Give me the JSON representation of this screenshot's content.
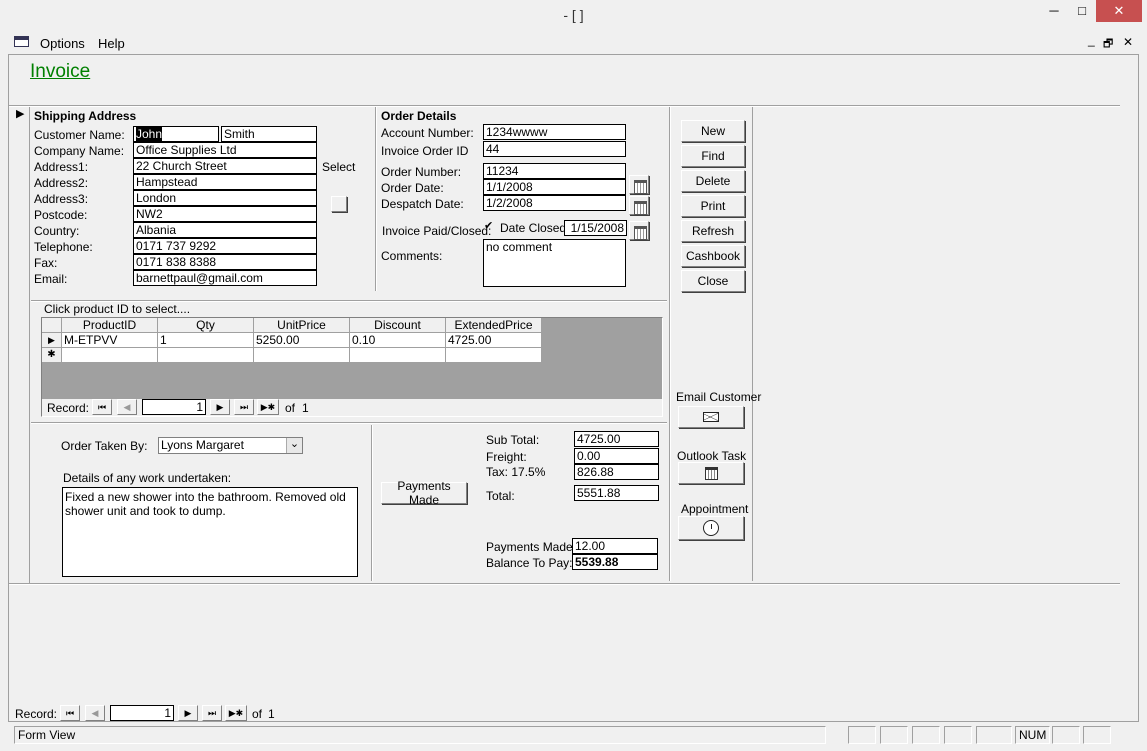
{
  "window": {
    "title": "- [ ]",
    "minimize": "─",
    "maximize": "□",
    "close": "✕"
  },
  "menu": {
    "options": "Options",
    "help": "Help",
    "mdi_min": "_",
    "mdi_restore": "🗗",
    "mdi_close": "✕"
  },
  "form": {
    "title": "Invoice"
  },
  "shipping": {
    "header": "Shipping Address",
    "select_label": "Select",
    "labels": {
      "customer_name": "Customer Name:",
      "company_name": "Company Name:",
      "address1": "Address1:",
      "address2": "Address2:",
      "address3": "Address3:",
      "postcode": "Postcode:",
      "country": "Country:",
      "telephone": "Telephone:",
      "fax": "Fax:",
      "email": "Email:"
    },
    "values": {
      "first_name": "John",
      "last_name": "Smith",
      "company_name": "Office Supplies Ltd",
      "address1": "22 Church Street",
      "address2": "Hampstead",
      "address3": "London",
      "postcode": "NW2",
      "country": "Albania",
      "telephone": "0171 737 9292",
      "fax": "0171 838 8388",
      "email": "barnettpaul@gmail.com"
    }
  },
  "order": {
    "header": "Order Details",
    "labels": {
      "account_number": "Account Number:",
      "invoice_order_id": "Invoice Order ID",
      "order_number": "Order Number:",
      "order_date": "Order Date:",
      "despatch_date": "Despatch Date:",
      "invoice_paid_closed": "Invoice Paid/Closed:",
      "date_closed": "Date Closed:",
      "comments": "Comments:"
    },
    "values": {
      "account_number": "1234wwww",
      "invoice_order_id": "44",
      "order_number": "11234",
      "order_date": "1/1/2008",
      "despatch_date": "1/2/2008",
      "date_closed": "1/15/2008",
      "comments": "no comment",
      "paid_checkmark": "✔"
    }
  },
  "actions": {
    "new": "New",
    "find": "Find",
    "delete": "Delete",
    "print": "Print",
    "refresh": "Refresh",
    "cashbook": "Cashbook",
    "close": "Close",
    "email_customer": "Email Customer",
    "outlook_task": "Outlook Task",
    "appointment": "Appointment"
  },
  "products": {
    "hint": "Click product ID to select....",
    "columns": [
      "ProductID",
      "Qty",
      "UnitPrice",
      "Discount",
      "ExtendedPrice"
    ],
    "rows": [
      [
        "M-ETPVV",
        "1",
        "5250.00",
        "0.10",
        "4725.00"
      ]
    ],
    "new_row_marker": "✱",
    "current_row_marker": "▶",
    "nav": {
      "label": "Record:",
      "current": "1",
      "of": "of",
      "total": "1"
    }
  },
  "work": {
    "order_taken_by_label": "Order Taken By:",
    "order_taken_by_value": "Lyons Margaret",
    "details_label": "Details of any work undertaken:",
    "details_value": "Fixed a new shower into the bathroom. Removed old shower unit and took to dump."
  },
  "totals": {
    "payments_made_button": "Payments Made",
    "labels": {
      "sub_total": "Sub Total:",
      "freight": "Freight:",
      "tax": "Tax: 17.5%",
      "total": "Total:",
      "payments_made": "Payments Made:",
      "balance": "Balance To Pay:"
    },
    "values": {
      "sub_total": "4725.00",
      "freight": "0.00",
      "tax": "826.88",
      "total": "5551.88",
      "payments_made": "12.00",
      "balance": "5539.88"
    }
  },
  "record_nav": {
    "label": "Record:",
    "current": "1",
    "of": "of",
    "total": "1"
  },
  "status": {
    "view": "Form View",
    "num": "NUM"
  },
  "glyphs": {
    "first": "⏮",
    "prev": "◀",
    "next": "▶",
    "last": "⏭",
    "new": "▶✱",
    "selector": "▶",
    "dropdown": "⌄"
  }
}
